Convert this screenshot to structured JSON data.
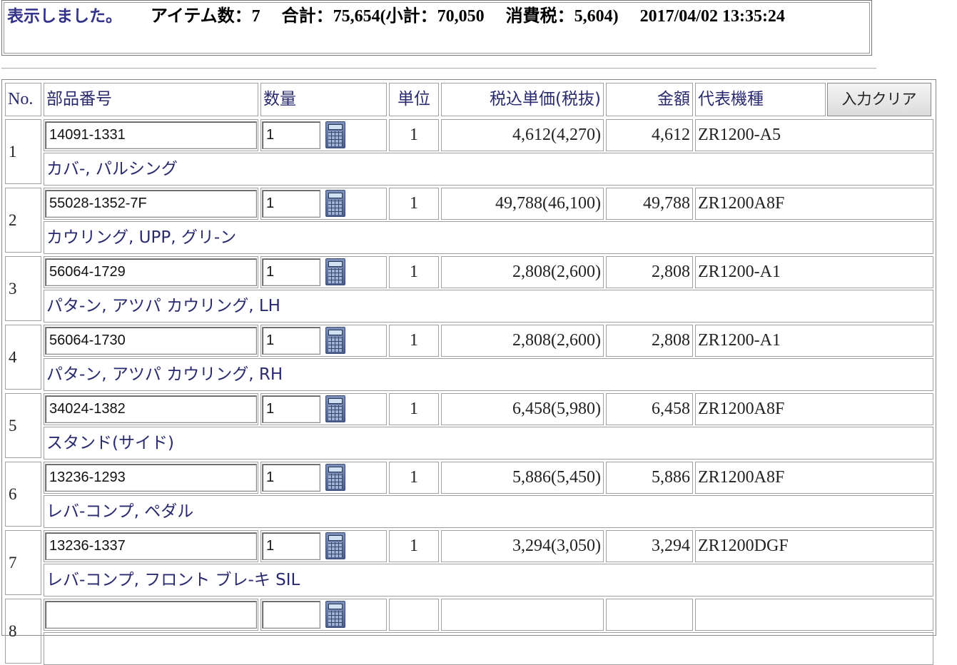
{
  "status": {
    "message": "表示しました。",
    "items_label": "アイテム数：7",
    "total_label": "合計：75,654(小計：70,050",
    "tax_label": "消費税：5,604)",
    "datetime": "2017/04/02 13:35:24"
  },
  "table": {
    "headers": {
      "no": "No.",
      "part_number": "部品番号",
      "quantity": "数量",
      "unit": "単位",
      "unit_price": "税込単価(税抜)",
      "amount": "金額",
      "model": "代表機種"
    },
    "clear_button": "入力クリア",
    "rows": [
      {
        "no": "1",
        "part_number": "14091-1331",
        "qty": "1",
        "unit": "1",
        "price": "4,612(4,270)",
        "amount": "4,612",
        "model": "ZR1200-A5",
        "description": "カバ-, パルシング"
      },
      {
        "no": "2",
        "part_number": "55028-1352-7F",
        "qty": "1",
        "unit": "1",
        "price": "49,788(46,100)",
        "amount": "49,788",
        "model": "ZR1200A8F",
        "description": "カウリング, UPP, グリ-ン"
      },
      {
        "no": "3",
        "part_number": "56064-1729",
        "qty": "1",
        "unit": "1",
        "price": "2,808(2,600)",
        "amount": "2,808",
        "model": "ZR1200-A1",
        "description": "パタ-ン, アツパ カウリング, LH"
      },
      {
        "no": "4",
        "part_number": "56064-1730",
        "qty": "1",
        "unit": "1",
        "price": "2,808(2,600)",
        "amount": "2,808",
        "model": "ZR1200-A1",
        "description": "パタ-ン, アツパ カウリング, RH"
      },
      {
        "no": "5",
        "part_number": "34024-1382",
        "qty": "1",
        "unit": "1",
        "price": "6,458(5,980)",
        "amount": "6,458",
        "model": "ZR1200A8F",
        "description": "スタンド(サイド)"
      },
      {
        "no": "6",
        "part_number": "13236-1293",
        "qty": "1",
        "unit": "1",
        "price": "5,886(5,450)",
        "amount": "5,886",
        "model": "ZR1200A8F",
        "description": "レバ-コンプ, ペダル"
      },
      {
        "no": "7",
        "part_number": "13236-1337",
        "qty": "1",
        "unit": "1",
        "price": "3,294(3,050)",
        "amount": "3,294",
        "model": "ZR1200DGF",
        "description": "レバ-コンプ, フロント ブレ-キ SIL"
      },
      {
        "no": "8",
        "part_number": "",
        "qty": "",
        "unit": "",
        "price": "",
        "amount": "",
        "model": "",
        "description": ""
      }
    ]
  }
}
